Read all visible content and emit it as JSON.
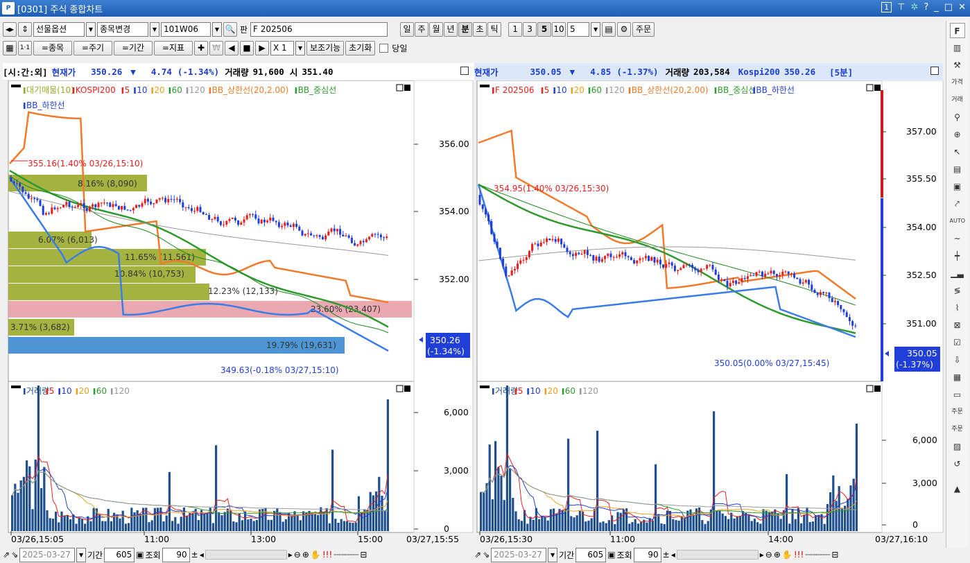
{
  "window": {
    "title": "[0301] 주식 종합차트",
    "logo": "P",
    "page_box": "1"
  },
  "toolbar1": {
    "market": "선물옵션",
    "change_item": "종목변경",
    "code": "101W06",
    "pan_label": "판",
    "instrument": "F 202506",
    "periods": [
      "일",
      "주",
      "월",
      "년",
      "분",
      "초",
      "틱"
    ],
    "selected_period": "분",
    "intervals": [
      "1",
      "3",
      "5",
      "10"
    ],
    "selected_interval": "5",
    "interval_input": "5",
    "order_button": "주문"
  },
  "toolbar2": {
    "tabs": [
      "=종목",
      "=주기",
      "=기간",
      "=지표"
    ],
    "multiplier": "X 1",
    "aux_button": "보조기능",
    "reset_button": "초기화",
    "today_label": "당일"
  },
  "left_header": {
    "mode": "[시:간:외]",
    "label": "현재가",
    "price": "350.26",
    "arrow": "▼",
    "change": "4.74",
    "pct": "(-1.34%)",
    "vol_label": "거래량",
    "volume": "91,600",
    "open_label": "시",
    "open": "351.40"
  },
  "right_header": {
    "label": "현재가",
    "price": "350.05",
    "arrow": "▼",
    "change": "4.85",
    "pct": "(-1.37%)",
    "vol_label": "거래량",
    "volume": "203,584",
    "idx_label": "Kospi200",
    "idx_value": "350.26",
    "period_tag": "[5분]"
  },
  "left_chart": {
    "legend_line1": [
      "대기매물(10)",
      "KOSPI200",
      "5",
      "10",
      "20",
      "60",
      "120",
      "BB_상한선(20,2.00)",
      "BB_중심선"
    ],
    "legend_line2": [
      "BB_하한선"
    ],
    "y_ticks": [
      "356.00",
      "354.00",
      "352.00"
    ],
    "high_label": "355.16(1.40% 03/26,15:10)",
    "low_label": "349.63(-0.18% 03/27,15:10)",
    "price_tag": [
      "350.26",
      "(-1.34%)"
    ],
    "supply_bars": [
      "8.16% (8,090)",
      "6.07% (6,013)",
      "11.65% (11,561)",
      "10.84% (10,753)",
      "12.23% (12,133)",
      "23.60% (23,407)",
      "3.71% (3,682)",
      "19.79% (19,631)"
    ]
  },
  "right_chart": {
    "legend_line1": [
      "F 202506",
      "5",
      "10",
      "20",
      "60",
      "120",
      "BB_상한선(20,2.00)",
      "BB_중심선",
      "BB_하한선"
    ],
    "y_ticks": [
      "357.00",
      "355.50",
      "354.00",
      "352.50",
      "351.00"
    ],
    "high_label": "354.95(1.40% 03/26,15:30)",
    "low_label": "350.05(0.00% 03/27,15:45)",
    "price_tag": [
      "350.05",
      "(-1.37%)"
    ]
  },
  "left_volume": {
    "legend": [
      "거래량",
      "5",
      "10",
      "20",
      "60",
      "120"
    ],
    "y_ticks": [
      "6,000",
      "3,000",
      "0"
    ]
  },
  "right_volume": {
    "legend": [
      "거래량",
      "5",
      "10",
      "20",
      "60",
      "120"
    ],
    "y_ticks": [
      "6,000",
      "3,000",
      "0"
    ]
  },
  "left_xaxis": {
    "labels": [
      "03/26,15:05",
      "11:00",
      "13:00",
      "15:00"
    ],
    "end": "03/27,15:55"
  },
  "right_xaxis": {
    "labels": [
      "03/26,15:30",
      "11:00",
      "14:00"
    ],
    "end": "03/27,16:10"
  },
  "left_bottom": {
    "date": "2025-03-27",
    "period_label": "기간",
    "count": "605",
    "query_label": "조회",
    "zoom": "90"
  },
  "right_bottom": {
    "date": "2025-03-27",
    "period_label": "기간",
    "count": "605",
    "query_label": "조회",
    "zoom": "90"
  },
  "colors": {
    "up": "#e8201c",
    "down": "#1f3fd8",
    "bb_upper": "#f07a2a",
    "bb_mid": "#2e9a2e",
    "bb_lower": "#3a7ce8",
    "supply": "#9aaa2a",
    "supply_red": "#e8a0a8",
    "supply_blue": "#3a8ad0",
    "vol": "#1f4f8f"
  }
}
